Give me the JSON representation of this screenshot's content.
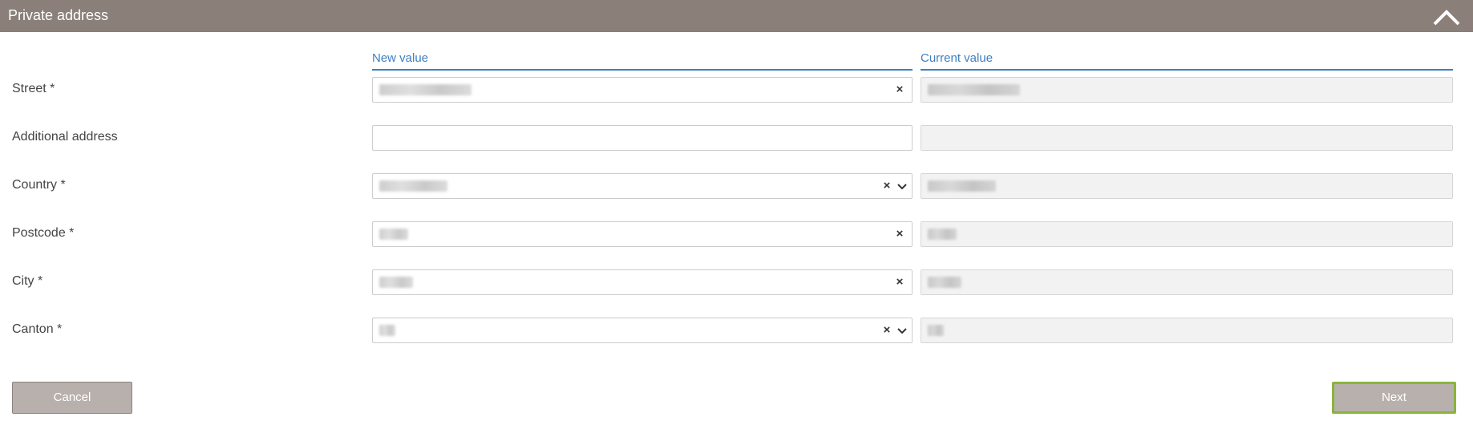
{
  "section": {
    "title": "Private address"
  },
  "columns": {
    "new_value": "New value",
    "current_value": "Current value"
  },
  "fields": [
    {
      "label": "Street *",
      "new_value": "Vollhardstrasse 23",
      "current_value": "Vollhardstrasse 23",
      "control": "text-clearable"
    },
    {
      "label": "Additional address",
      "new_value": "",
      "current_value": "",
      "control": "text"
    },
    {
      "label": "Country *",
      "new_value": "Switzerland",
      "current_value": "Switzerland",
      "control": "select-clearable"
    },
    {
      "label": "Postcode *",
      "new_value": "4058",
      "current_value": "4058",
      "control": "text-clearable"
    },
    {
      "label": "City *",
      "new_value": "Basel",
      "current_value": "Basel",
      "control": "text-clearable"
    },
    {
      "label": "Canton *",
      "new_value": "BS",
      "current_value": "BS",
      "control": "select-clearable"
    }
  ],
  "buttons": {
    "cancel": "Cancel",
    "next": "Next"
  },
  "colors": {
    "header_bg": "#8a7f79",
    "accent": "#3f7fc1",
    "button_bg": "#b8b0ac",
    "focus_border": "#8ab43a"
  },
  "icons": {
    "collapse": "chevron-up-icon",
    "clear": "clear-x-icon",
    "dropdown": "chevron-down-icon"
  }
}
